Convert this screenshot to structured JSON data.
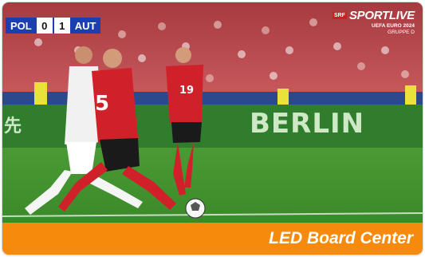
{
  "scoreboard": {
    "home_team": "POL",
    "home_score": "0",
    "away_score": "1",
    "away_team": "AUT"
  },
  "broadcaster": {
    "badge": "SRF",
    "brand": "SPORTLIVE",
    "event": "UEFA EURO 2024",
    "group": "GRUPPE D"
  },
  "stadium_board": {
    "city": "BERLIN"
  },
  "players": {
    "red_number_left": "5",
    "red_number_right": "19"
  },
  "banner": {
    "title": "LED Board Center"
  },
  "colors": {
    "banner": "#f58a0d",
    "austria_kit": "#d0202a",
    "poland_kit": "#ffffff",
    "pitch": "#3f8f2e",
    "scoreboard": "#1b3fb0"
  }
}
